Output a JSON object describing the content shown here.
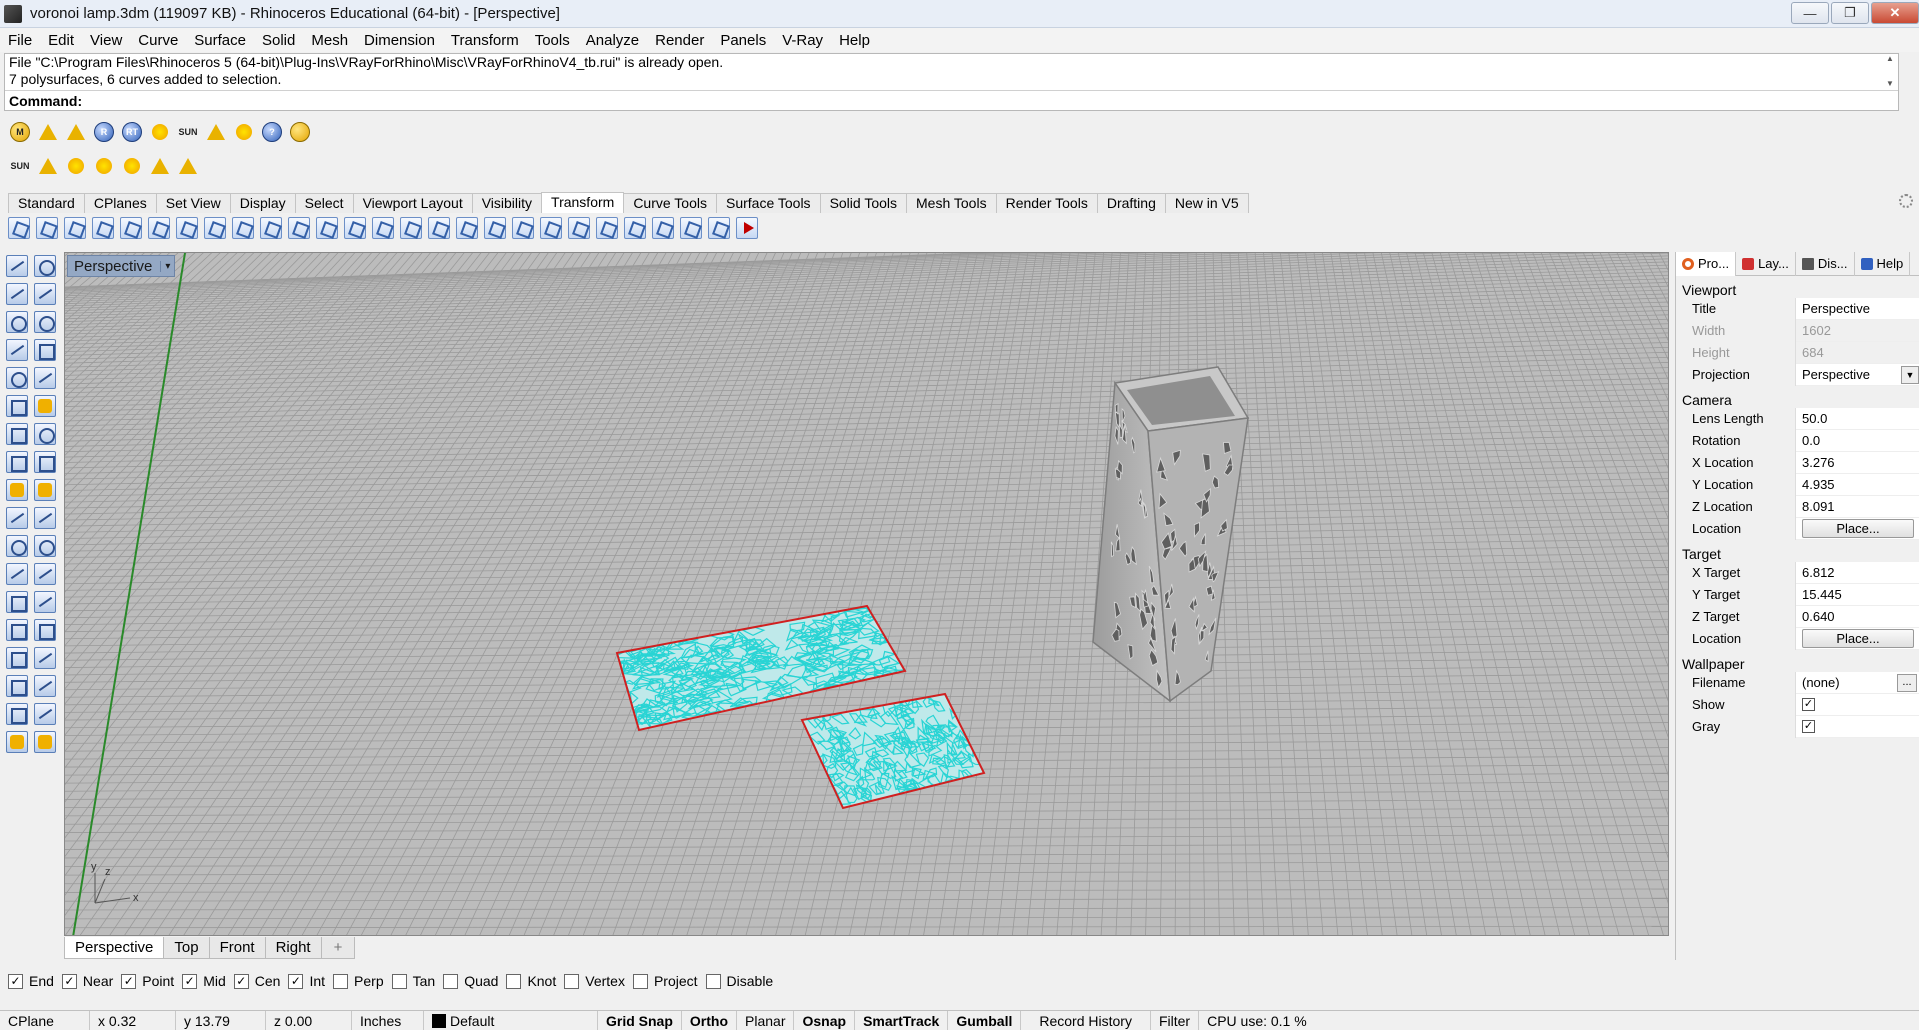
{
  "window": {
    "title": "voronoi lamp.3dm (119097 KB) - Rhinoceros Educational (64-bit) - [Perspective]",
    "min": "—",
    "max": "❐",
    "close": "✕"
  },
  "menubar": [
    "File",
    "Edit",
    "View",
    "Curve",
    "Surface",
    "Solid",
    "Mesh",
    "Dimension",
    "Transform",
    "Tools",
    "Analyze",
    "Render",
    "Panels",
    "V-Ray",
    "Help"
  ],
  "command": {
    "history": [
      "File \"C:\\Program Files\\Rhinoceros 5 (64-bit)\\Plug-Ins\\VRayForRhino\\Misc\\VRayForRhinoV4_tb.rui\" is already open.",
      "7 polysurfaces, 6 curves added to selection."
    ],
    "prompt": "Command:",
    "value": ""
  },
  "toolbar_vray1": [
    "M",
    "",
    "",
    "R",
    "RT",
    "",
    "SUN",
    "",
    "",
    "?",
    ""
  ],
  "toolbar_vray2": [
    "SUN",
    "",
    "",
    "",
    "",
    "",
    ""
  ],
  "tabs": [
    "Standard",
    "CPlanes",
    "Set View",
    "Display",
    "Select",
    "Viewport Layout",
    "Visibility",
    "Transform",
    "Curve Tools",
    "Surface Tools",
    "Solid Tools",
    "Mesh Tools",
    "Render Tools",
    "Drafting",
    "New in V5"
  ],
  "active_tab": "Transform",
  "viewport": {
    "title": "Perspective",
    "caret": "▾",
    "axis_x": "x",
    "axis_y": "y",
    "axis_z": "z"
  },
  "viewport_tabs": [
    "Perspective",
    "Top",
    "Front",
    "Right",
    "+"
  ],
  "panel": {
    "tabs": [
      "Pro...",
      "Lay...",
      "Dis...",
      "Help"
    ],
    "sections": {
      "viewport": "Viewport",
      "camera": "Camera",
      "target": "Target",
      "wallpaper": "Wallpaper"
    },
    "viewport_rows": [
      {
        "label": "Title",
        "value": "Perspective"
      },
      {
        "label": "Width",
        "value": "1602"
      },
      {
        "label": "Height",
        "value": "684"
      },
      {
        "label": "Projection",
        "value": "Perspective"
      }
    ],
    "camera_rows": [
      {
        "label": "Lens Length",
        "value": "50.0"
      },
      {
        "label": "Rotation",
        "value": "0.0"
      },
      {
        "label": "X Location",
        "value": "3.276"
      },
      {
        "label": "Y Location",
        "value": "4.935"
      },
      {
        "label": "Z Location",
        "value": "8.091"
      },
      {
        "label": "Location",
        "value": "Place..."
      }
    ],
    "target_rows": [
      {
        "label": "X Target",
        "value": "6.812"
      },
      {
        "label": "Y Target",
        "value": "15.445"
      },
      {
        "label": "Z Target",
        "value": "0.640"
      },
      {
        "label": "Location",
        "value": "Place..."
      }
    ],
    "wallpaper_rows": [
      {
        "label": "Filename",
        "value": "(none)"
      },
      {
        "label": "Show",
        "value": "✓"
      },
      {
        "label": "Gray",
        "value": "✓"
      }
    ]
  },
  "osnap": [
    {
      "label": "End",
      "checked": true
    },
    {
      "label": "Near",
      "checked": true
    },
    {
      "label": "Point",
      "checked": true
    },
    {
      "label": "Mid",
      "checked": true
    },
    {
      "label": "Cen",
      "checked": true
    },
    {
      "label": "Int",
      "checked": true
    },
    {
      "label": "Perp",
      "checked": false
    },
    {
      "label": "Tan",
      "checked": false
    },
    {
      "label": "Quad",
      "checked": false
    },
    {
      "label": "Knot",
      "checked": false
    },
    {
      "label": "Vertex",
      "checked": false
    },
    {
      "label": "Project",
      "checked": false
    },
    {
      "label": "Disable",
      "checked": false
    }
  ],
  "status": {
    "cplane": "CPlane",
    "x": "x 0.32",
    "y": "y 13.79",
    "z": "z 0.00",
    "units": "Inches",
    "layer": "Default",
    "grid_snap": "Grid Snap",
    "ortho": "Ortho",
    "planar": "Planar",
    "osnap": "Osnap",
    "smarttrack": "SmartTrack",
    "gumball": "Gumball",
    "record_history": "Record History",
    "filter": "Filter",
    "cpu": "CPU use: 0.1 %"
  },
  "colors": {
    "grid_bg": "#bcbcbc",
    "grid_line": "#9a9a9a",
    "y_axis": "#2a8a2a",
    "selection_curve": "#28d4d4",
    "selection_box": "#d02020",
    "lamp": "#a8a8a8"
  }
}
